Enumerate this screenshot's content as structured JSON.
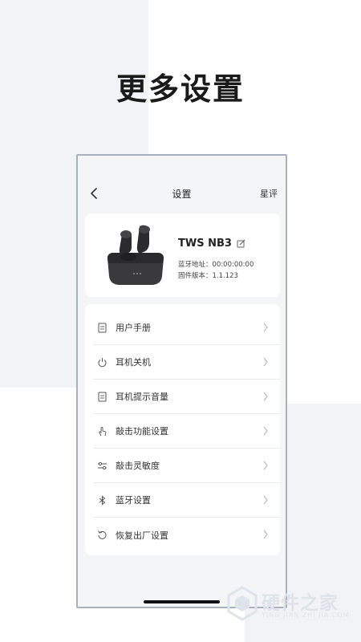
{
  "promo": {
    "title": "更多设置"
  },
  "navbar": {
    "title": "设置",
    "right_action": "星评",
    "back_icon": "back-arrow-icon"
  },
  "device": {
    "name": "TWS NB3",
    "bluetooth_address": "蓝牙地址：00:00:00:00",
    "firmware_version": "固件版本：1.1.123"
  },
  "menu": {
    "items": [
      {
        "label": "用户手册",
        "icon": "manual-icon"
      },
      {
        "label": "耳机关机",
        "icon": "power-icon"
      },
      {
        "label": "耳机提示音量",
        "icon": "document-icon"
      },
      {
        "label": "敲击功能设置",
        "icon": "tap-icon"
      },
      {
        "label": "敲击灵敏度",
        "icon": "sliders-icon"
      },
      {
        "label": "蓝牙设置",
        "icon": "bluetooth-icon"
      },
      {
        "label": "恢复出厂设置",
        "icon": "reset-icon"
      }
    ]
  },
  "watermark": {
    "text": "硬件之家",
    "subtext": "YING JIAN ZHI JIA.COM"
  },
  "colors": {
    "background_panel": "#f1f3f6",
    "phone_border": "#a9afbc",
    "card": "#ffffff",
    "divider": "#e9eaed"
  }
}
